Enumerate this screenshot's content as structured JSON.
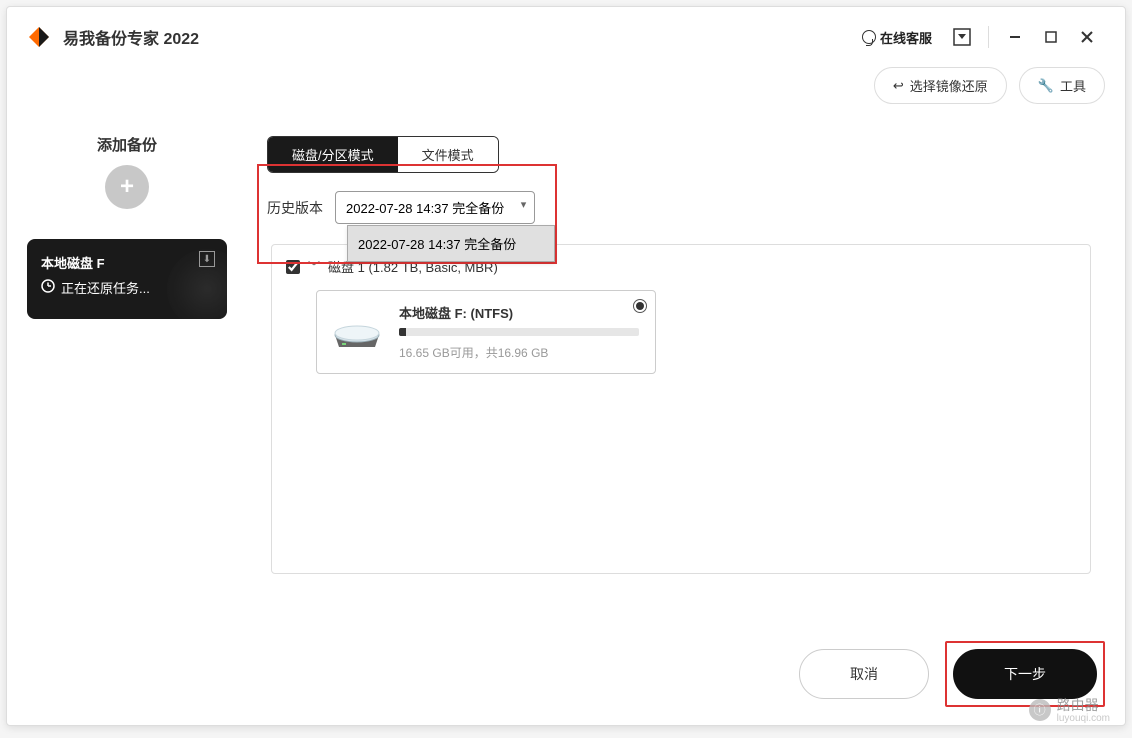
{
  "app": {
    "title": "易我备份专家 2022",
    "support": "在线客服"
  },
  "toolbar": {
    "restore_image": "选择镜像还原",
    "tools": "工具"
  },
  "sidebar": {
    "add_backup": "添加备份",
    "card": {
      "title": "本地磁盘 F",
      "status": "正在还原任务..."
    }
  },
  "main": {
    "tabs": {
      "disk_mode": "磁盘/分区模式",
      "file_mode": "文件模式"
    },
    "history_label": "历史版本",
    "history_selected": "2022-07-28 14:37 完全备份",
    "history_options": [
      "2022-07-28 14:37 完全备份"
    ],
    "disk": {
      "label": "磁盘 1 (1.82 TB, Basic, MBR)",
      "checked": true
    },
    "partition": {
      "name": "本地磁盘 F: (NTFS)",
      "free_text": "16.65 GB可用，共16.96 GB",
      "used_pct": 3,
      "selected": true
    }
  },
  "footer": {
    "cancel": "取消",
    "next": "下一步"
  },
  "watermark": {
    "text": "路由器",
    "sub": "luyouqi.com"
  }
}
